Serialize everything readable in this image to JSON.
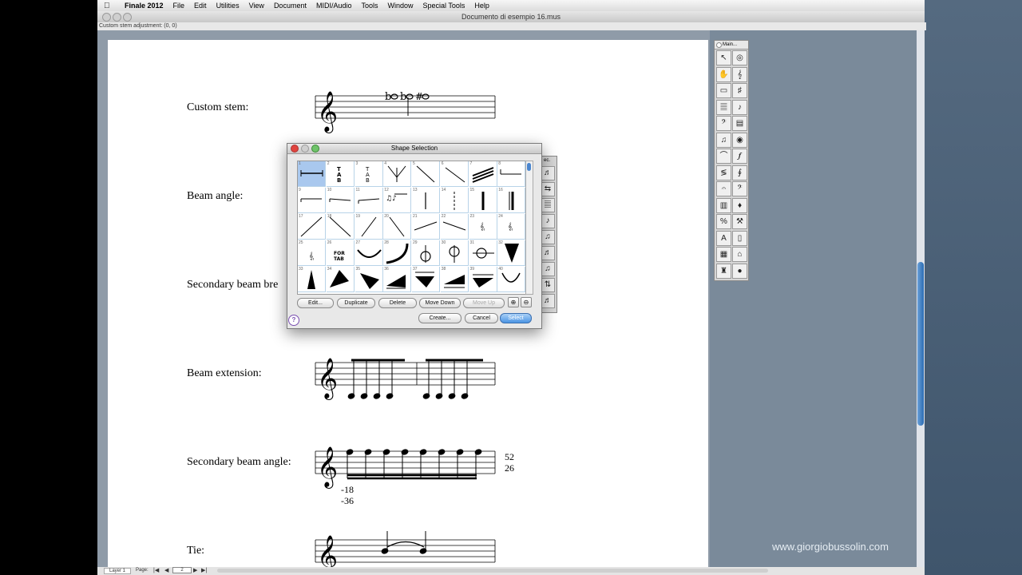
{
  "menubar": {
    "items": [
      "Finale 2012",
      "File",
      "Edit",
      "Utilities",
      "View",
      "Document",
      "MIDI/Audio",
      "Tools",
      "Window",
      "Special Tools",
      "Help"
    ]
  },
  "window": {
    "title": "Documento di esempio 16.mus"
  },
  "status": {
    "text": "Custom stem adjustment: (0, 0)"
  },
  "score": {
    "labels": [
      "Custom stem:",
      "Beam angle:",
      "Secondary beam bre",
      "Beam extension:",
      "Secondary beam angle:",
      "Tie:"
    ],
    "sba_right_top": "52",
    "sba_right_bottom": "26",
    "sba_below_top": "-18",
    "sba_below_bottom": "-36"
  },
  "palette": {
    "title": "Main..."
  },
  "dialog": {
    "title": "Shape Selection",
    "cell_numbers": [
      "1",
      "2",
      "3",
      "4",
      "5",
      "6",
      "7",
      "8",
      "9",
      "10",
      "11",
      "12",
      "13",
      "14",
      "15",
      "16",
      "17",
      "18",
      "19",
      "20",
      "21",
      "22",
      "23",
      "24",
      "25",
      "26",
      "27",
      "28",
      "29",
      "30",
      "31",
      "32",
      "33",
      "34",
      "35",
      "36",
      "37",
      "38",
      "39",
      "40"
    ],
    "tab_text": [
      "T",
      "A",
      "B"
    ],
    "for_tab": [
      "FOR",
      "TAB"
    ],
    "buttons": {
      "edit": "Edit...",
      "duplicate": "Duplicate",
      "delete": "Delete",
      "move_down": "Move Down",
      "move_up": "Move Up",
      "create": "Create...",
      "cancel": "Cancel",
      "select": "Select"
    },
    "help": "?"
  },
  "sidepal_title": "ec.",
  "bottombar": {
    "layer": "Layer 1",
    "page_label": "Page:",
    "page_value": "2"
  },
  "watermark": "www.giorgiobussolin.com",
  "icons": [
    "apple-icon",
    "zoom-in-icon",
    "zoom-out-icon",
    "help-icon"
  ]
}
